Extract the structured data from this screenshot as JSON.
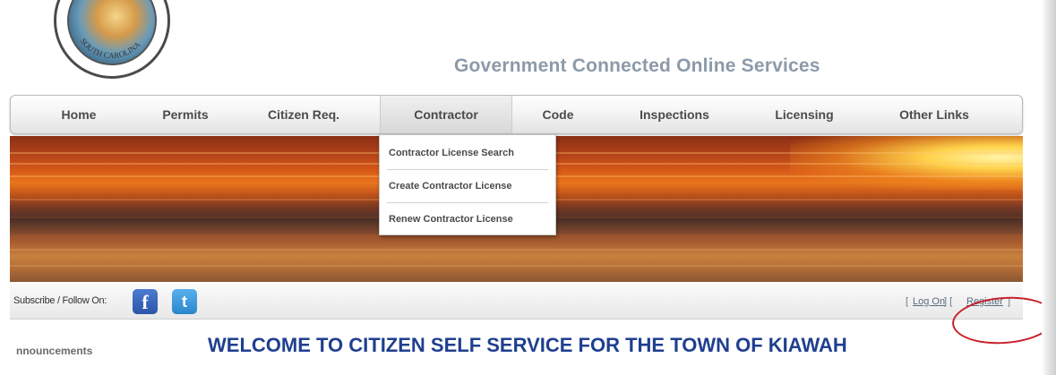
{
  "header": {
    "site_title": "Government Connected Online Services",
    "seal_text": "SOUTH CAROLINA"
  },
  "nav": {
    "items": [
      {
        "label": "Home"
      },
      {
        "label": "Permits"
      },
      {
        "label": "Citizen Req."
      },
      {
        "label": "Contractor"
      },
      {
        "label": "Code"
      },
      {
        "label": "Inspections"
      },
      {
        "label": "Licensing"
      },
      {
        "label": "Other Links"
      }
    ],
    "active": "Contractor"
  },
  "dropdown": {
    "items": [
      {
        "label": "Contractor License Search"
      },
      {
        "label": "Create Contractor License"
      },
      {
        "label": "Renew Contractor License"
      }
    ]
  },
  "social": {
    "label": "Subscribe / Follow On:",
    "facebook_glyph": "f",
    "twitter_glyph": "t",
    "icons": [
      "facebook-icon",
      "twitter-icon"
    ]
  },
  "auth": {
    "open1": "[",
    "logon": "Log On",
    "mid": "] [",
    "register": "Register",
    "close": "]"
  },
  "main": {
    "announcements": "nnouncements",
    "welcome": "WELCOME TO CITIZEN SELF SERVICE FOR THE TOWN OF KIAWAH"
  },
  "colors": {
    "title": "#8c9aa8",
    "welcome": "#1f3f8f",
    "annotation_circle": "#c8202a"
  }
}
